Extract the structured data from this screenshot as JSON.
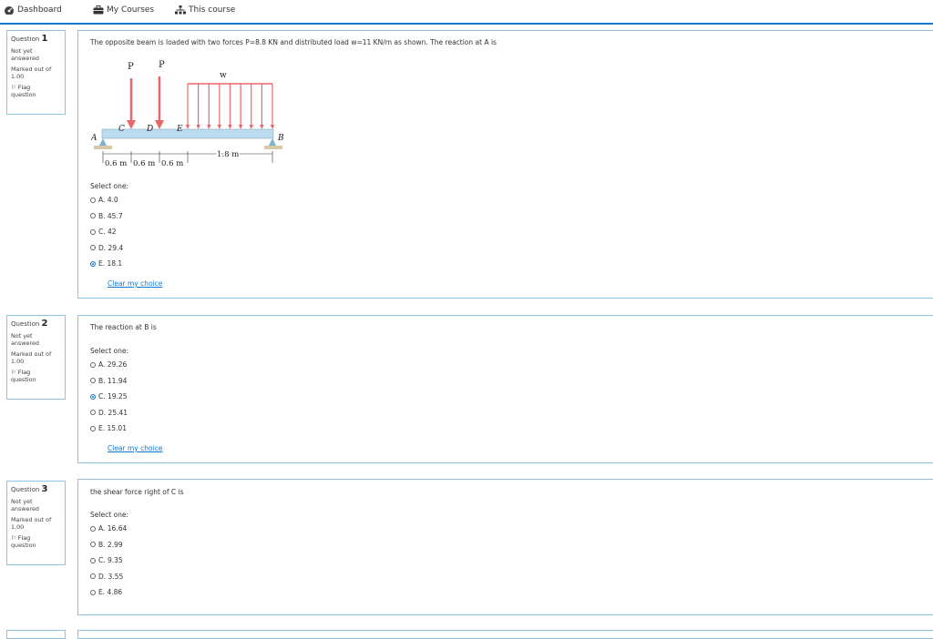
{
  "nav": {
    "dashboard": "Dashboard",
    "my_courses": "My Courses",
    "this_course": "This course"
  },
  "questions": [
    {
      "label": "Question",
      "number": "1",
      "status": [
        "Not yet",
        "answered"
      ],
      "marked": [
        "Marked out of",
        "1.00"
      ],
      "flag": [
        "Flag",
        "question"
      ],
      "text": "The opposite beam is loaded with two forces P=8.8 KN and distributed load w=11 KN/m as shown. The reaction at A is",
      "select": "Select one:",
      "options": [
        "A. 4.0",
        "B. 45.7",
        "C. 42",
        "D. 29.4",
        "E. 18.1"
      ],
      "selected": 4,
      "clear": "Clear my choice"
    },
    {
      "label": "Question",
      "number": "2",
      "status": [
        "Not yet",
        "answered"
      ],
      "marked": [
        "Marked out of",
        "1.00"
      ],
      "flag": [
        "Flag",
        "question"
      ],
      "text": "The reaction at B is",
      "select": "Select one:",
      "options": [
        "A. 29.26",
        "B. 11.94",
        "C. 19.25",
        "D. 25.41",
        "E. 15.01"
      ],
      "selected": 2,
      "clear": "Clear my choice"
    },
    {
      "label": "Question",
      "number": "3",
      "status": [
        "Not yet",
        "answered"
      ],
      "marked": [
        "Marked out of",
        "1.00"
      ],
      "flag": [
        "Flag",
        "question"
      ],
      "text": "the shear force right of C is",
      "select": "Select one:",
      "options": [
        "A. 16.64",
        "B. 2.99",
        "C. 9.35",
        "D. 3.55",
        "E. 4.86"
      ],
      "selected": -1
    }
  ],
  "figure": {
    "force_labels": [
      "P",
      "P"
    ],
    "load_label": "w",
    "points": [
      "A",
      "C",
      "D",
      "E",
      "B"
    ],
    "dims": [
      "0.6 m",
      "0.6 m",
      "0.6 m",
      "1.8 m"
    ]
  },
  "colors": {
    "accent": "#1177d1",
    "border": "#8bc4e6",
    "arrow": "#e8676b",
    "beam": "#bcdcef"
  }
}
